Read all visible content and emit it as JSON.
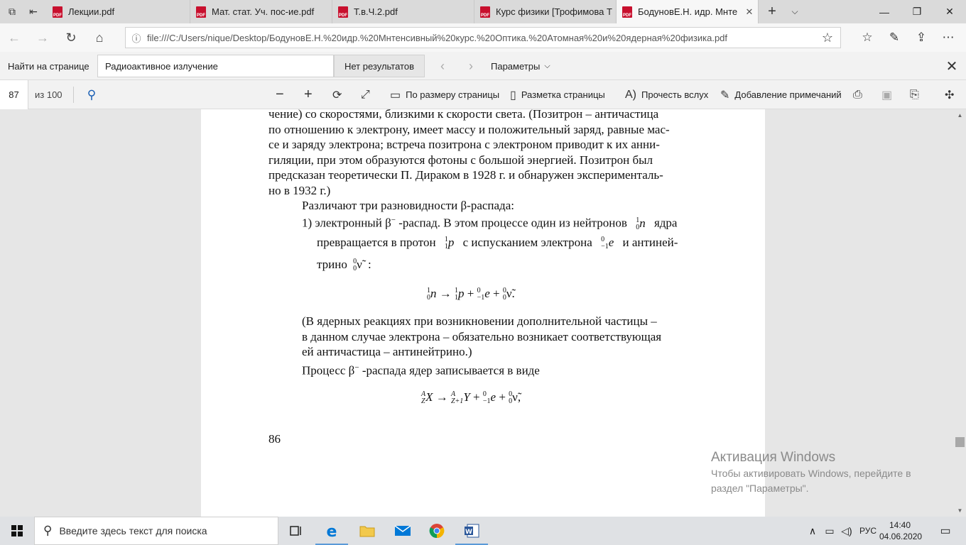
{
  "tabs": [
    {
      "title": "Лекции.pdf",
      "active": false
    },
    {
      "title": "Мат. стат. Уч. пос-ие.pdf",
      "active": false
    },
    {
      "title": "Т.в.Ч.2.pdf",
      "active": false
    },
    {
      "title": "Курс физики [Трофимова Т",
      "active": false
    },
    {
      "title": "БодуновЕ.Н. идр. Мнте",
      "active": true
    }
  ],
  "pdf_badge": "PDF",
  "address": "file:///C:/Users/nique/Desktop/БодуновЕ.Н.%20идр.%20Мнтенсивный%20курс.%20Оптика.%20Атомная%20и%20ядерная%20физика.pdf",
  "find": {
    "label": "Найти на странице",
    "query": "Радиоактивное излучение",
    "result": "Нет результатов",
    "params": "Параметры"
  },
  "pdf_toolbar": {
    "page": "87",
    "of": "из 100",
    "fit": "По размеру страницы",
    "layout": "Разметка страницы",
    "read_aloud": "Прочесть вслух",
    "annotate": "Добавление примечаний"
  },
  "doc": {
    "para1": [
      "чение) со скоростями, близкими к скорости света. (Позитрон – античастица",
      "по отношению к электрону, имеет массу и положительный заряд, равные мас-",
      "се и заряду электрона; встреча позитрона с электроном приводит к их анни-",
      "гиляции, при этом образуются фотоны с большой энергией. Позитрон был",
      "предсказан теоретически П. Дираком в 1928 г. и обнаружен эксперименталь-",
      "но в 1932 г.)"
    ],
    "variants_intro": "Различают три разновидности β-распада:",
    "item1_a": "1) электронный β",
    "item1_b": "-распад. В этом процессе один из нейтронов",
    "item1_c": "ядра",
    "item1_line2a": "превращается в протон",
    "item1_line2b": "с испусканием электрона",
    "item1_line2c": "и антиней-",
    "item1_line3a": "трино",
    "para2": [
      "(В ядерных реакциях при возникновении дополнительной частицы –",
      "в данном случае электрона – обязательно возникает соответствующая",
      "ей античастица – антинейтрино.)"
    ],
    "process_a": "Процесс β",
    "process_b": "-распада ядер записывается в виде",
    "page_number": "86"
  },
  "watermark": {
    "title": "Активация Windows",
    "line1": "Чтобы активировать Windows, перейдите в",
    "line2": "раздел \"Параметры\"."
  },
  "taskbar": {
    "search_placeholder": "Введите здесь текст для поиска",
    "lang": "РУС",
    "time": "14:40",
    "date": "04.06.2020"
  },
  "colors": {
    "pdf_icon": "#c8102e",
    "accent": "#1a5fb4",
    "word": "#2b579a",
    "edge": "#0078d7"
  }
}
